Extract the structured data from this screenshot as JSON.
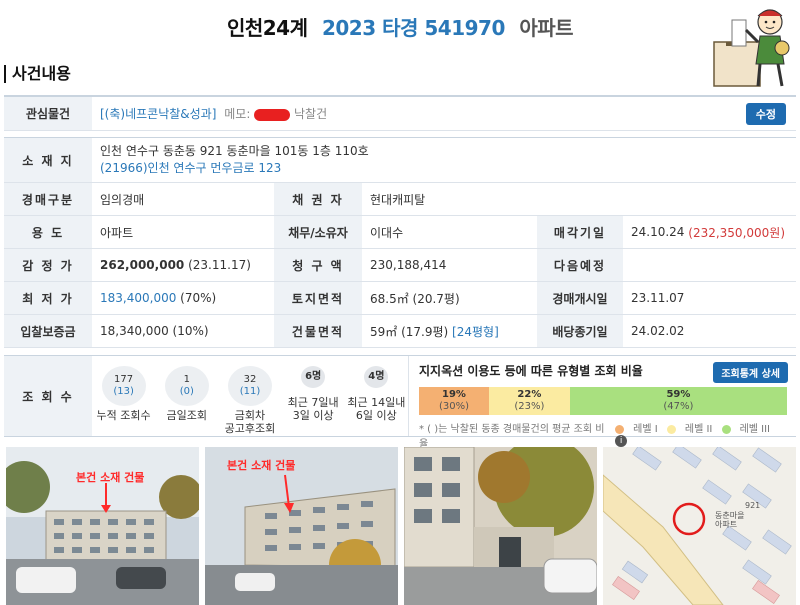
{
  "header": {
    "court": "인천24계",
    "case_no": "2023 타경 541970",
    "property_type": "아파트"
  },
  "section_title": "사건내용",
  "interest": {
    "label": "관심물건",
    "owner": "[(축)네프콘낙찰&성과]",
    "memo_label": "메모:",
    "memo_text": "낙찰건",
    "edit_label": "수정"
  },
  "address": {
    "label": "소 재 지",
    "line1": "인천 연수구 동춘동 921 동춘마을 101동 1층 110호",
    "line2": "(21966)인천 연수구  먼우금로  123"
  },
  "rows": {
    "auction_type_label": "경매구분",
    "auction_type": "임의경매",
    "creditor_label": "채 권 자",
    "creditor": "현대캐피탈",
    "usage_label": "용   도",
    "usage": "아파트",
    "debtor_label": "채무/소유자",
    "debtor": "이대수",
    "sale_date_label": "매각기일",
    "sale_date": "24.10.24",
    "sale_price": "(232,350,000원)",
    "appraisal_label": "감 정 가",
    "appraisal": "262,000,000",
    "appraisal_date": "(23.11.17)",
    "claim_label": "청 구 액",
    "claim": "230,188,414",
    "next_label": "다음예정",
    "next": "",
    "min_label": "최 저 가",
    "min_price": "183,400,000",
    "min_pct": "(70%)",
    "land_label": "토지면적",
    "land_area": "68.5㎡ (20.7평)",
    "start_label": "경매개시일",
    "start_date": "23.11.07",
    "deposit_label": "입찰보증금",
    "deposit": "18,340,000 (10%)",
    "building_label": "건물면적",
    "building_area": "59㎡ (17.9평)",
    "building_pyeong": "[24평형]",
    "dividend_label": "배당종기일",
    "dividend_date": "24.02.02"
  },
  "views": {
    "label": "조 회 수",
    "items": [
      {
        "main": "177",
        "sub": "(13)",
        "caption": "누적 조회수"
      },
      {
        "main": "1",
        "sub": "(0)",
        "caption": "금일조회"
      },
      {
        "main": "32",
        "sub": "(11)",
        "caption": "금회차\n공고후조회"
      },
      {
        "main": "6명",
        "sub": "",
        "caption": "최근 7일내\n3일 이상"
      },
      {
        "main": "4명",
        "sub": "",
        "caption": "최근 14일내\n6일 이상"
      }
    ]
  },
  "ratio": {
    "title": "지지옥션 이용도 등에 따른 유형별 조회 비율",
    "stat_button": "조회통계 상세",
    "segments": [
      {
        "pct": "19%",
        "sub": "(30%)",
        "value": 19,
        "color": "#f4b072"
      },
      {
        "pct": "22%",
        "sub": "(23%)",
        "value": 22,
        "color": "#fbeba1"
      },
      {
        "pct": "59%",
        "sub": "(47%)",
        "value": 59,
        "color": "#a9e07f"
      }
    ],
    "note": "* ( )는 낙찰된 동종 경매물건의 평균 조회 비율",
    "legend": [
      "레벨 I",
      "레벨 II",
      "레벨 III"
    ]
  },
  "photos": {
    "tag1": "본건 소재 건물",
    "tag2": "본건 소재 건물",
    "map_label1": "동춘마을\n아파트",
    "map_label2": "921"
  }
}
